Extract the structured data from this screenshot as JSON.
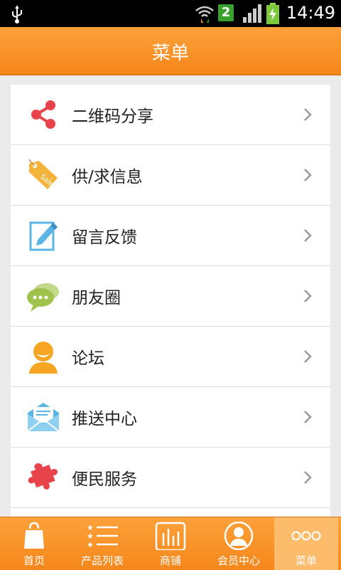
{
  "status_bar": {
    "time": "14:49",
    "sim_number": "2"
  },
  "header": {
    "title": "菜单"
  },
  "menu": {
    "items": [
      {
        "label": "二维码分享",
        "icon": "share-icon"
      },
      {
        "label": "供/求信息",
        "icon": "sale-tag-icon"
      },
      {
        "label": "留言反馈",
        "icon": "edit-note-icon"
      },
      {
        "label": "朋友圈",
        "icon": "chat-bubbles-icon"
      },
      {
        "label": "论坛",
        "icon": "user-avatar-icon"
      },
      {
        "label": "推送中心",
        "icon": "mail-icon"
      },
      {
        "label": "便民服务",
        "icon": "puzzle-icon"
      }
    ]
  },
  "tab_bar": {
    "tabs": [
      {
        "label": "首页",
        "icon": "shopping-bag-icon"
      },
      {
        "label": "产品列表",
        "icon": "list-icon"
      },
      {
        "label": "商铺",
        "icon": "store-chart-icon"
      },
      {
        "label": "会员中心",
        "icon": "member-icon"
      },
      {
        "label": "菜单",
        "icon": "more-icon",
        "active": true
      }
    ]
  },
  "colors": {
    "accent": "#f7901e",
    "share_red": "#e8424a",
    "sale_orange": "#f4b43c",
    "edit_blue": "#5bb6e6",
    "chat_green": "#9ec24a",
    "avatar_orange": "#f6a623"
  }
}
